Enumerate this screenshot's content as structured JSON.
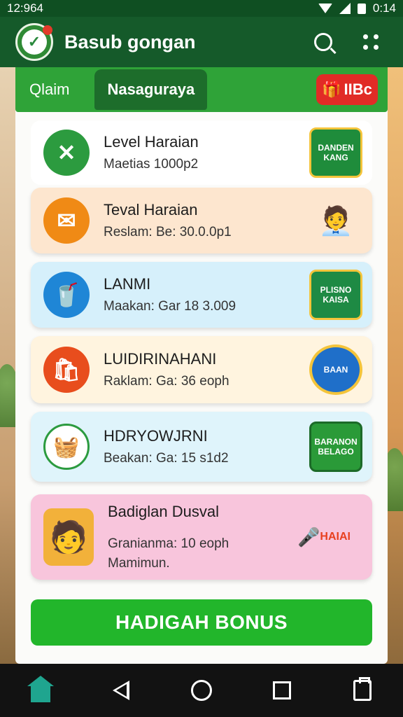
{
  "status": {
    "time": "12:964",
    "right_time": "0:14"
  },
  "appbar": {
    "title": "Basub gongan"
  },
  "tabs": [
    {
      "label": "Qlaim"
    },
    {
      "label": "Nasaguraya"
    }
  ],
  "tab_badge": {
    "label": "IIBc"
  },
  "tasks": [
    {
      "title": "Level Haraian",
      "sub": "Maetias 1000p2",
      "promo": "DANDEN KANG",
      "colors": {
        "bg": "#ffffff",
        "icon": "#2c9b3f",
        "promo": "#1f8c3b"
      }
    },
    {
      "title": "Teval Haraian",
      "sub": "Reslam: Be: 30.0.0p1",
      "promo": "",
      "colors": {
        "bg": "#fde6cf",
        "icon": "#f08a15",
        "promo": "#e9b57e"
      }
    },
    {
      "title": "LANMI",
      "sub": "Maakan: Gar 18 3.009",
      "promo": "PLISNO KAISA",
      "colors": {
        "bg": "#d6f0fb",
        "icon": "#1f86d6",
        "promo": "#1e8a44"
      }
    },
    {
      "title": "LUIDIRINAHANI",
      "sub": "Raklam: Ga: 36 eoph",
      "promo": "BAAN",
      "colors": {
        "bg": "#fff4df",
        "icon": "#e84d1d",
        "promo": "#1f6fc9"
      }
    },
    {
      "title": "HDRYOWJRNI",
      "sub": "Beakan: Ga: 15 s1d2",
      "promo": "BARANON BELAGO",
      "colors": {
        "bg": "#dff4fb",
        "icon": "#ffffff",
        "promo": "#2a9a38"
      }
    },
    {
      "title": "Badiglan Dusval",
      "sub": "Granianma: 10 eoph",
      "sub2": "Mamimun.",
      "promo": "HAIAI",
      "colors": {
        "bg": "#f8c5dc",
        "icon": "#f2b13a",
        "promo": "#f4c43a"
      }
    }
  ],
  "bonus_button": {
    "label": "HADIGAH BONUS"
  }
}
